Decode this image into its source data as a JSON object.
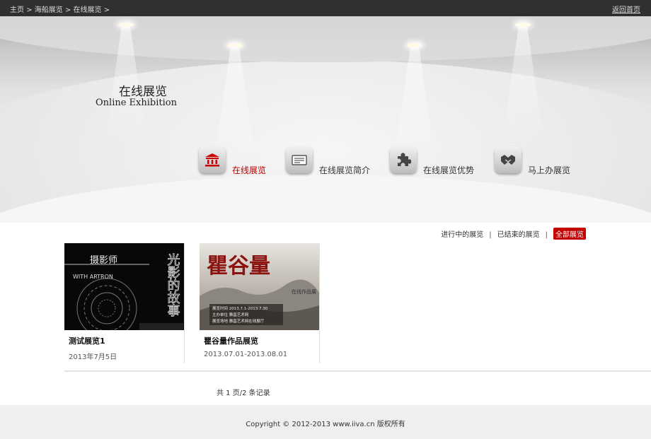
{
  "breadcrumb": {
    "items": [
      "主页",
      "海船展览",
      "在线展览"
    ],
    "separator": ">",
    "home_link": "返回首页"
  },
  "hero": {
    "title_zh": "在线展览",
    "title_en": "Online Exhibition"
  },
  "nav": {
    "items": [
      {
        "label": "在线展览",
        "icon": "museum-icon",
        "active": true
      },
      {
        "label": "在线展览简介",
        "icon": "card-icon",
        "active": false
      },
      {
        "label": "在线展览优势",
        "icon": "puzzle-icon",
        "active": false
      },
      {
        "label": "马上办展览",
        "icon": "handshake-icon",
        "active": false
      }
    ]
  },
  "filters": {
    "items": [
      "进行中的展览",
      "已结束的展览",
      "全部展览"
    ],
    "active": "全部展览"
  },
  "exhibitions": [
    {
      "name": "测试展览1",
      "date": "2013年7月5日",
      "poster": {
        "lines": [
          "光影的故事",
          "WITH ARTRON",
          "摄影师"
        ]
      }
    },
    {
      "name": "瞿谷量作品展览",
      "date": "2013.07.01-2013.08.01",
      "poster": {
        "title": "瞿谷量",
        "subtitle": "在线作品展",
        "info": [
          "展览时间 2013.7.1-2013.7.30",
          "主办单位 雅昌艺术网",
          "展览场地 雅昌艺术网在线展厅"
        ]
      }
    }
  ],
  "pager": {
    "text": "共 1 页/2 条记录"
  },
  "footer": {
    "copyright": "Copyright © 2012-2013 www.iiva.cn 版权所有"
  },
  "colors": {
    "accent": "#c30000",
    "topbar": "#303030"
  }
}
